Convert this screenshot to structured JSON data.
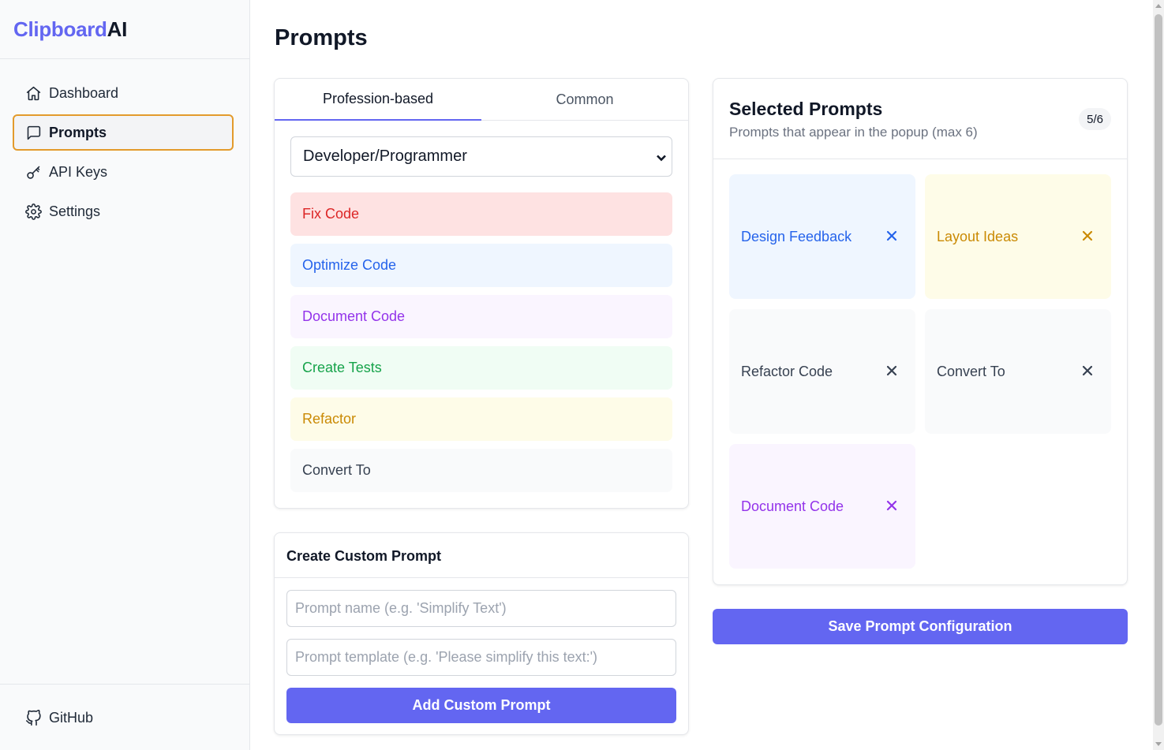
{
  "app": {
    "brand_part1": "Clipboard",
    "brand_part2": "AI"
  },
  "sidebar": {
    "items": [
      {
        "label": "Dashboard",
        "icon": "home-icon"
      },
      {
        "label": "Prompts",
        "icon": "message-square-icon",
        "active": true
      },
      {
        "label": "API Keys",
        "icon": "key-icon"
      },
      {
        "label": "Settings",
        "icon": "gear-icon"
      }
    ],
    "footer": {
      "label": "GitHub",
      "icon": "github-icon"
    }
  },
  "page": {
    "title": "Prompts"
  },
  "tabs": [
    {
      "label": "Profession-based",
      "active": true
    },
    {
      "label": "Common",
      "active": false
    }
  ],
  "profession_select": {
    "value": "Developer/Programmer"
  },
  "prompt_list": [
    {
      "label": "Fix Code",
      "bg": "#fee2e2",
      "color": "#dc2626"
    },
    {
      "label": "Optimize Code",
      "bg": "#eff6ff",
      "color": "#2563eb"
    },
    {
      "label": "Document Code",
      "bg": "#faf5ff",
      "color": "#9333ea"
    },
    {
      "label": "Create Tests",
      "bg": "#f0fdf4",
      "color": "#16a34a"
    },
    {
      "label": "Refactor",
      "bg": "#fefce8",
      "color": "#ca8a04"
    },
    {
      "label": "Convert To",
      "bg": "#f9fafb",
      "color": "#374151"
    }
  ],
  "custom_prompt": {
    "title": "Create Custom Prompt",
    "name_placeholder": "Prompt name (e.g. 'Simplify Text')",
    "template_placeholder": "Prompt template (e.g. 'Please simplify this text:')",
    "add_label": "Add Custom Prompt"
  },
  "selected": {
    "title": "Selected Prompts",
    "subtitle": "Prompts that appear in the popup (max 6)",
    "count": "5/6",
    "items": [
      {
        "label": "Design Feedback",
        "bg": "#eff6ff",
        "color": "#2563eb"
      },
      {
        "label": "Layout Ideas",
        "bg": "#fefce8",
        "color": "#ca8a04"
      },
      {
        "label": "Refactor Code",
        "bg": "#f9fafb",
        "color": "#374151"
      },
      {
        "label": "Convert To",
        "bg": "#f9fafb",
        "color": "#374151"
      },
      {
        "label": "Document Code",
        "bg": "#faf5ff",
        "color": "#9333ea"
      }
    ]
  },
  "save_label": "Save Prompt Configuration",
  "accent_color": "#6366f1"
}
